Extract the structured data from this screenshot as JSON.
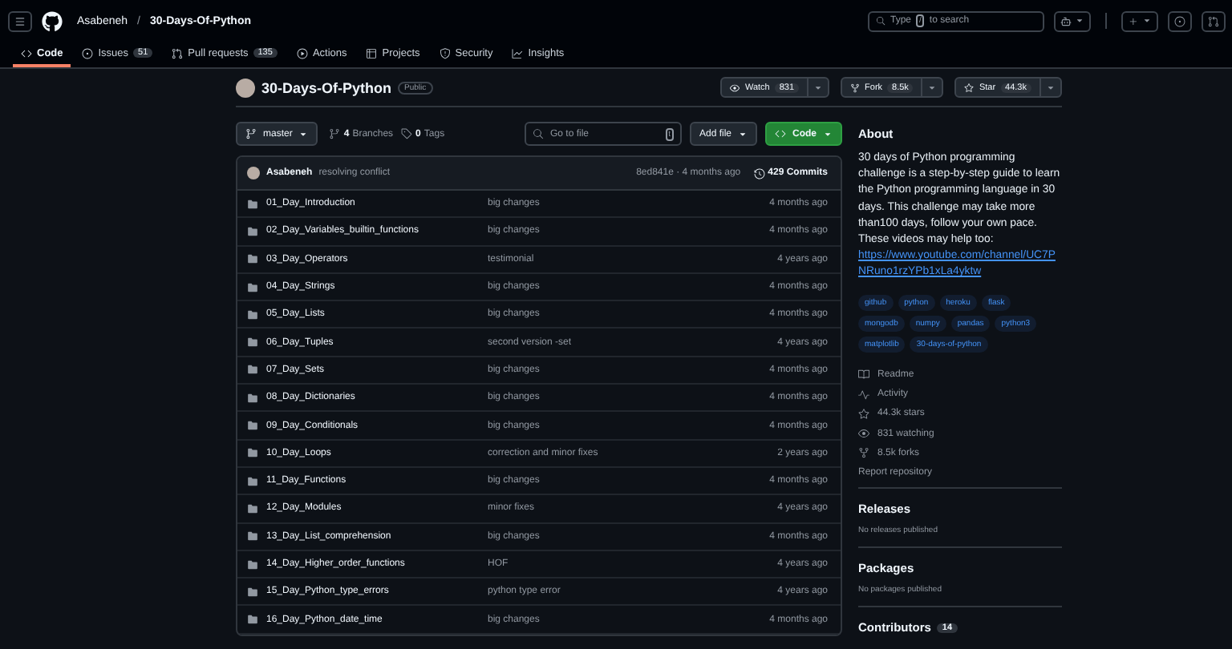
{
  "topbar": {
    "owner": "Asabeneh",
    "separator": "/",
    "repo": "30-Days-Of-Python",
    "search": {
      "prefix": "Type",
      "key": "/",
      "suffix": "to search"
    }
  },
  "tabs": [
    {
      "label": "Code",
      "selected": true
    },
    {
      "label": "Issues",
      "count": "51",
      "selected": false
    },
    {
      "label": "Pull requests",
      "count": "135",
      "selected": false
    },
    {
      "label": "Actions",
      "selected": false
    },
    {
      "label": "Projects",
      "selected": false
    },
    {
      "label": "Security",
      "selected": false
    },
    {
      "label": "Insights",
      "selected": false
    }
  ],
  "repo": {
    "name": "30-Days-Of-Python",
    "visibility": "Public"
  },
  "repo_actions": [
    {
      "kind": "watch",
      "label": "Watch",
      "count": "831"
    },
    {
      "kind": "fork",
      "label": "Fork",
      "count": "8.5k"
    },
    {
      "kind": "star",
      "label": "Star",
      "count": "44.3k"
    }
  ],
  "toolbar": {
    "branch": "master",
    "branches_count": "4",
    "branches_label": "Branches",
    "tags_count": "0",
    "tags_label": "Tags",
    "go_to_file": {
      "placeholder": "Go to file",
      "key": "t"
    },
    "add_file": "Add file",
    "code": "Code"
  },
  "commit": {
    "author": "Asabeneh",
    "message": "resolving conflict",
    "hash_time": "8ed841e · 4 months ago",
    "commits": "429 Commits"
  },
  "files": [
    {
      "name": "01_Day_Introduction",
      "message": "big changes",
      "time": "4 months ago"
    },
    {
      "name": "02_Day_Variables_builtin_functions",
      "message": "big changes",
      "time": "4 months ago"
    },
    {
      "name": "03_Day_Operators",
      "message": "testimonial",
      "time": "4 years ago"
    },
    {
      "name": "04_Day_Strings",
      "message": "big changes",
      "time": "4 months ago"
    },
    {
      "name": "05_Day_Lists",
      "message": "big changes",
      "time": "4 months ago"
    },
    {
      "name": "06_Day_Tuples",
      "message": "second version -set",
      "time": "4 years ago"
    },
    {
      "name": "07_Day_Sets",
      "message": "big changes",
      "time": "4 months ago"
    },
    {
      "name": "08_Day_Dictionaries",
      "message": "big changes",
      "time": "4 months ago"
    },
    {
      "name": "09_Day_Conditionals",
      "message": "big changes",
      "time": "4 months ago"
    },
    {
      "name": "10_Day_Loops",
      "message": "correction and minor fixes",
      "time": "2 years ago"
    },
    {
      "name": "11_Day_Functions",
      "message": "big changes",
      "time": "4 months ago"
    },
    {
      "name": "12_Day_Modules",
      "message": "minor fixes",
      "time": "4 years ago"
    },
    {
      "name": "13_Day_List_comprehension",
      "message": "big changes",
      "time": "4 months ago"
    },
    {
      "name": "14_Day_Higher_order_functions",
      "message": "HOF",
      "time": "4 years ago"
    },
    {
      "name": "15_Day_Python_type_errors",
      "message": "python type error",
      "time": "4 years ago"
    },
    {
      "name": "16_Day_Python_date_time",
      "message": "big changes",
      "time": "4 months ago"
    }
  ],
  "about": {
    "title": "About",
    "description": "30 days of Python programming challenge is a step-by-step guide to learn the Python programming language in 30 days. This challenge may take more than100 days, follow your own pace. These videos may help too:",
    "link": "https://www.youtube.com/channel/UC7PNRuno1rzYPb1xLa4yktw",
    "topics": [
      "github",
      "python",
      "heroku",
      "flask",
      "mongodb",
      "numpy",
      "pandas",
      "python3",
      "matplotlib",
      "30-days-of-python"
    ],
    "stats": [
      {
        "kind": "readme",
        "label": "Readme"
      },
      {
        "kind": "activity",
        "label": "Activity"
      },
      {
        "kind": "stars",
        "label": "44.3k stars"
      },
      {
        "kind": "watching",
        "label": "831 watching"
      },
      {
        "kind": "forks",
        "label": "8.5k forks"
      },
      {
        "kind": "report",
        "label": "Report repository"
      }
    ]
  },
  "sections": [
    {
      "title": "Releases",
      "text": "No releases published"
    },
    {
      "title": "Packages",
      "text": "No packages published"
    },
    {
      "title": "Contributors",
      "count": "14"
    }
  ]
}
